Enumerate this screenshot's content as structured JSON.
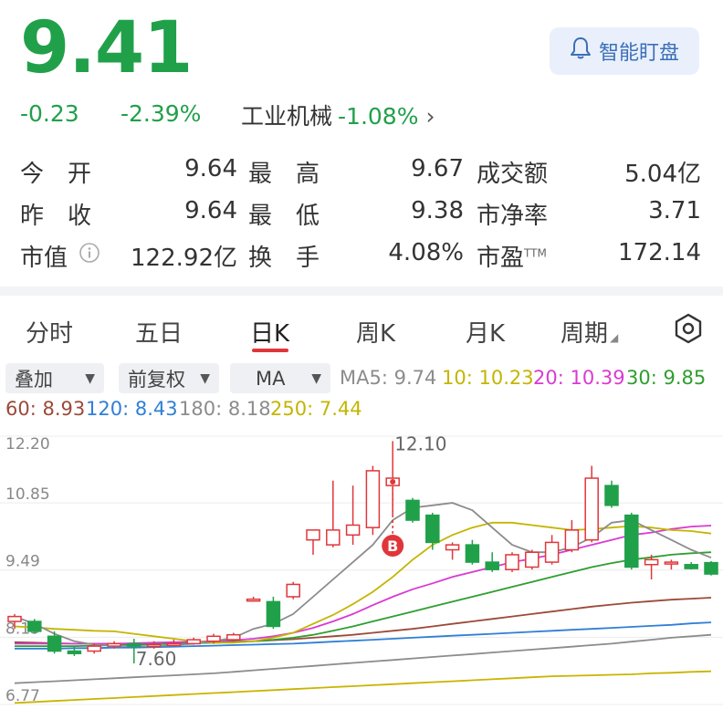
{
  "quote": {
    "price": "9.41",
    "change": "-0.23",
    "change_pct": "-2.39%",
    "industry": "工业机械",
    "industry_pct": "-1.08%",
    "industry_arrow": "›"
  },
  "watch_button": {
    "label": "智能盯盘",
    "icon": "bell-icon"
  },
  "stats": {
    "open_label": "今　开",
    "open": "9.64",
    "high_label": "最　高",
    "high": "9.67",
    "turnover_amt_label": "成交额",
    "turnover_amt": "5.04亿",
    "prev_close_label": "昨　收",
    "prev_close": "9.64",
    "low_label": "最　低",
    "low": "9.38",
    "pb_label": "市净率",
    "pb": "3.71",
    "mkt_cap_label": "市值",
    "mkt_cap": "122.92亿",
    "turnover_rate_label": "换　手",
    "turnover_rate": "4.08%",
    "pe_label": "市盈",
    "pe_sup": "TTM",
    "pe": "172.14"
  },
  "tabs": [
    "分时",
    "五日",
    "日K",
    "周K",
    "月K",
    "周期"
  ],
  "active_tab": "日K",
  "settings_icon": "settings-icon",
  "controls": {
    "overlay": "叠加",
    "adjust": "前复权",
    "indicator": "MA"
  },
  "ma_legend": {
    "ma5": "MA5: 9.74",
    "ma10": "10: 10.23",
    "ma20": "20: 10.39",
    "ma30": "30: 9.85",
    "ma60": "60: 8.93",
    "ma120": "120: 8.43",
    "ma180": "180: 8.18",
    "ma250": "250: 7.44"
  },
  "colors": {
    "up": "#e0363a",
    "down": "#21a04a",
    "ma5": "#8c8c8c",
    "ma10": "#c4b500",
    "ma20": "#d93ad3",
    "ma30": "#2f9e2f",
    "ma60": "#9b4a3a",
    "ma120": "#2f7fd6",
    "ma180": "#8c8c8c",
    "ma250": "#c9b400"
  },
  "chart_data": {
    "type": "candlestick",
    "y_ticks": [
      "12.20",
      "10.85",
      "9.49",
      "8.13",
      "6.77"
    ],
    "ylim": [
      6.77,
      12.2
    ],
    "annotations": {
      "high_label": "12.10",
      "low_label": "7.60",
      "buy_marker": "B"
    },
    "candles": [
      {
        "o": 8.45,
        "h": 8.6,
        "l": 8.3,
        "c": 8.55
      },
      {
        "o": 8.45,
        "h": 8.5,
        "l": 8.2,
        "c": 8.25
      },
      {
        "o": 8.15,
        "h": 8.25,
        "l": 7.8,
        "c": 7.85
      },
      {
        "o": 7.85,
        "h": 7.95,
        "l": 7.75,
        "c": 7.8
      },
      {
        "o": 7.85,
        "h": 8.0,
        "l": 7.8,
        "c": 7.95
      },
      {
        "o": 7.95,
        "h": 8.05,
        "l": 7.9,
        "c": 8.0
      },
      {
        "o": 8.0,
        "h": 8.1,
        "l": 7.6,
        "c": 7.95
      },
      {
        "o": 7.95,
        "h": 8.05,
        "l": 7.9,
        "c": 7.98
      },
      {
        "o": 7.98,
        "h": 8.08,
        "l": 7.95,
        "c": 8.0
      },
      {
        "o": 8.0,
        "h": 8.12,
        "l": 7.98,
        "c": 8.08
      },
      {
        "o": 8.05,
        "h": 8.2,
        "l": 8.0,
        "c": 8.15
      },
      {
        "o": 8.08,
        "h": 8.22,
        "l": 8.05,
        "c": 8.18
      },
      {
        "o": 8.9,
        "h": 8.95,
        "l": 8.85,
        "c": 8.9
      },
      {
        "o": 8.85,
        "h": 8.95,
        "l": 8.3,
        "c": 8.35
      },
      {
        "o": 8.95,
        "h": 9.25,
        "l": 8.9,
        "c": 9.2
      },
      {
        "o": 10.1,
        "h": 10.25,
        "l": 9.8,
        "c": 10.3
      },
      {
        "o": 10.0,
        "h": 11.3,
        "l": 9.95,
        "c": 10.3
      },
      {
        "o": 10.2,
        "h": 11.2,
        "l": 10.0,
        "c": 10.4
      },
      {
        "o": 10.35,
        "h": 11.6,
        "l": 10.2,
        "c": 11.5
      },
      {
        "o": 11.2,
        "h": 12.1,
        "l": 10.6,
        "c": 11.35
      },
      {
        "o": 10.9,
        "h": 10.95,
        "l": 10.45,
        "c": 10.5
      },
      {
        "o": 10.6,
        "h": 10.65,
        "l": 9.9,
        "c": 10.05
      },
      {
        "o": 9.9,
        "h": 10.05,
        "l": 9.7,
        "c": 10.0
      },
      {
        "o": 10.0,
        "h": 10.1,
        "l": 9.6,
        "c": 9.65
      },
      {
        "o": 9.65,
        "h": 9.85,
        "l": 9.45,
        "c": 9.5
      },
      {
        "o": 9.5,
        "h": 9.85,
        "l": 9.45,
        "c": 9.8
      },
      {
        "o": 9.55,
        "h": 9.9,
        "l": 9.5,
        "c": 9.85
      },
      {
        "o": 9.65,
        "h": 10.2,
        "l": 9.6,
        "c": 10.05
      },
      {
        "o": 9.9,
        "h": 10.5,
        "l": 9.85,
        "c": 10.3
      },
      {
        "o": 10.1,
        "h": 11.6,
        "l": 10.05,
        "c": 11.35
      },
      {
        "o": 11.2,
        "h": 11.3,
        "l": 10.75,
        "c": 10.8
      },
      {
        "o": 10.6,
        "h": 10.65,
        "l": 9.5,
        "c": 9.55
      },
      {
        "o": 9.6,
        "h": 9.8,
        "l": 9.3,
        "c": 9.7
      },
      {
        "o": 9.65,
        "h": 9.7,
        "l": 9.5,
        "c": 9.65
      },
      {
        "o": 9.6,
        "h": 9.65,
        "l": 9.5,
        "c": 9.52
      },
      {
        "o": 9.64,
        "h": 9.67,
        "l": 9.38,
        "c": 9.41
      }
    ],
    "ma": {
      "ma5": [
        8.55,
        8.4,
        8.2,
        8.05,
        7.98,
        7.96,
        7.95,
        7.95,
        7.97,
        8.0,
        8.05,
        8.12,
        8.3,
        8.4,
        8.6,
        8.95,
        9.3,
        9.65,
        10.0,
        10.5,
        10.75,
        10.8,
        10.85,
        10.7,
        10.35,
        10.0,
        9.85,
        9.85,
        9.95,
        10.15,
        10.45,
        10.5,
        10.3,
        10.1,
        9.9,
        9.74
      ],
      "ma10": [
        8.35,
        8.33,
        8.3,
        8.28,
        8.26,
        8.25,
        8.2,
        8.15,
        8.1,
        8.05,
        8.02,
        8.02,
        8.05,
        8.12,
        8.22,
        8.4,
        8.58,
        8.8,
        9.05,
        9.35,
        9.7,
        10.0,
        10.2,
        10.35,
        10.45,
        10.45,
        10.4,
        10.35,
        10.3,
        10.32,
        10.35,
        10.38,
        10.35,
        10.3,
        10.28,
        10.23
      ],
      "ma20": [
        8.0,
        8.0,
        8.0,
        8.0,
        8.0,
        8.0,
        8.01,
        8.02,
        8.03,
        8.04,
        8.05,
        8.07,
        8.1,
        8.15,
        8.22,
        8.32,
        8.45,
        8.6,
        8.78,
        8.95,
        9.1,
        9.22,
        9.35,
        9.45,
        9.55,
        9.65,
        9.72,
        9.8,
        9.9,
        10.0,
        10.1,
        10.2,
        10.25,
        10.32,
        10.37,
        10.39
      ],
      "ma30": [
        7.95,
        7.95,
        7.95,
        7.95,
        7.96,
        7.97,
        7.98,
        7.99,
        8.0,
        8.01,
        8.02,
        8.03,
        8.05,
        8.08,
        8.12,
        8.18,
        8.26,
        8.35,
        8.45,
        8.55,
        8.65,
        8.75,
        8.85,
        8.95,
        9.05,
        9.15,
        9.25,
        9.35,
        9.45,
        9.55,
        9.63,
        9.7,
        9.75,
        9.8,
        9.83,
        9.85
      ],
      "ma60": [
        8.03,
        8.02,
        8.01,
        8.0,
        8.0,
        8.0,
        8.0,
        8.0,
        8.01,
        8.02,
        8.03,
        8.04,
        8.05,
        8.07,
        8.09,
        8.12,
        8.15,
        8.18,
        8.22,
        8.26,
        8.3,
        8.35,
        8.4,
        8.45,
        8.5,
        8.55,
        8.6,
        8.65,
        8.7,
        8.75,
        8.79,
        8.83,
        8.86,
        8.89,
        8.91,
        8.93
      ],
      "ma120": [
        7.9,
        7.9,
        7.9,
        7.91,
        7.91,
        7.92,
        7.92,
        7.93,
        7.94,
        7.95,
        7.96,
        7.97,
        7.98,
        7.99,
        8.0,
        8.02,
        8.04,
        8.06,
        8.08,
        8.1,
        8.12,
        8.14,
        8.16,
        8.18,
        8.2,
        8.22,
        8.24,
        8.26,
        8.28,
        8.3,
        8.32,
        8.34,
        8.36,
        8.38,
        8.41,
        8.43
      ],
      "ma180": [
        7.2,
        7.22,
        7.24,
        7.26,
        7.28,
        7.3,
        7.32,
        7.34,
        7.36,
        7.38,
        7.4,
        7.43,
        7.46,
        7.49,
        7.52,
        7.55,
        7.58,
        7.61,
        7.64,
        7.67,
        7.7,
        7.73,
        7.76,
        7.79,
        7.82,
        7.85,
        7.88,
        7.91,
        7.94,
        7.97,
        8.0,
        8.04,
        8.08,
        8.12,
        8.15,
        8.18
      ],
      "ma250": [
        6.8,
        6.82,
        6.84,
        6.86,
        6.88,
        6.9,
        6.92,
        6.94,
        6.96,
        6.98,
        7.0,
        7.02,
        7.04,
        7.06,
        7.08,
        7.1,
        7.12,
        7.14,
        7.16,
        7.18,
        7.2,
        7.22,
        7.24,
        7.26,
        7.28,
        7.3,
        7.32,
        7.34,
        7.35,
        7.36,
        7.37,
        7.38,
        7.4,
        7.41,
        7.43,
        7.44
      ]
    }
  }
}
